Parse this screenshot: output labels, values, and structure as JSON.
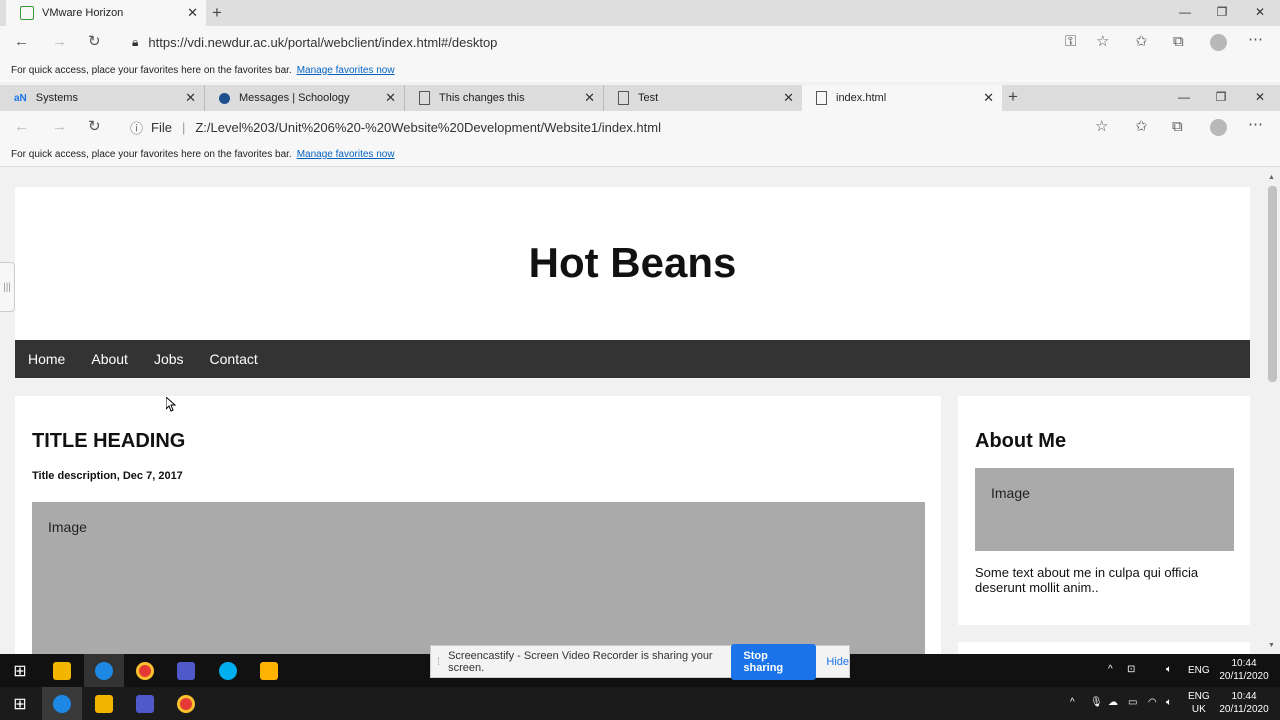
{
  "outer_browser": {
    "tab_title": "VMware Horizon",
    "url": "https://vdi.newdur.ac.uk/portal/webclient/index.html#/desktop",
    "fav_text": "For quick access, place your favorites here on the favorites bar.",
    "fav_link": "Manage favorites now"
  },
  "inner_browser": {
    "tabs": [
      {
        "label": "Systems"
      },
      {
        "label": "Messages | Schoology"
      },
      {
        "label": "This changes this"
      },
      {
        "label": "Test"
      },
      {
        "label": "index.html"
      }
    ],
    "file_label": "File",
    "url": "Z:/Level%203/Unit%206%20-%20Website%20Development/Website1/index.html",
    "fav_text": "For quick access, place your favorites here on the favorites bar.",
    "fav_link": "Manage favorites now"
  },
  "site": {
    "title": "Hot Beans",
    "nav": [
      "Home",
      "About",
      "Jobs",
      "Contact"
    ],
    "main": {
      "heading": "TITLE HEADING",
      "description": "Title description, Dec 7, 2017",
      "image_label": "Image"
    },
    "aside": {
      "heading": "About Me",
      "image_label": "Image",
      "text": "Some text about me in culpa qui officia deserunt mollit anim.."
    }
  },
  "screencastify": {
    "message": "Screencastify - Screen Video Recorder is sharing your screen.",
    "stop": "Stop sharing",
    "hide": "Hide"
  },
  "taskbar_inner": {
    "lang": "ENG",
    "time": "10:44",
    "date": "20/11/2020"
  },
  "taskbar_outer": {
    "lang": "ENG",
    "region": "UK",
    "time": "10:44",
    "date": "20/11/2020"
  }
}
